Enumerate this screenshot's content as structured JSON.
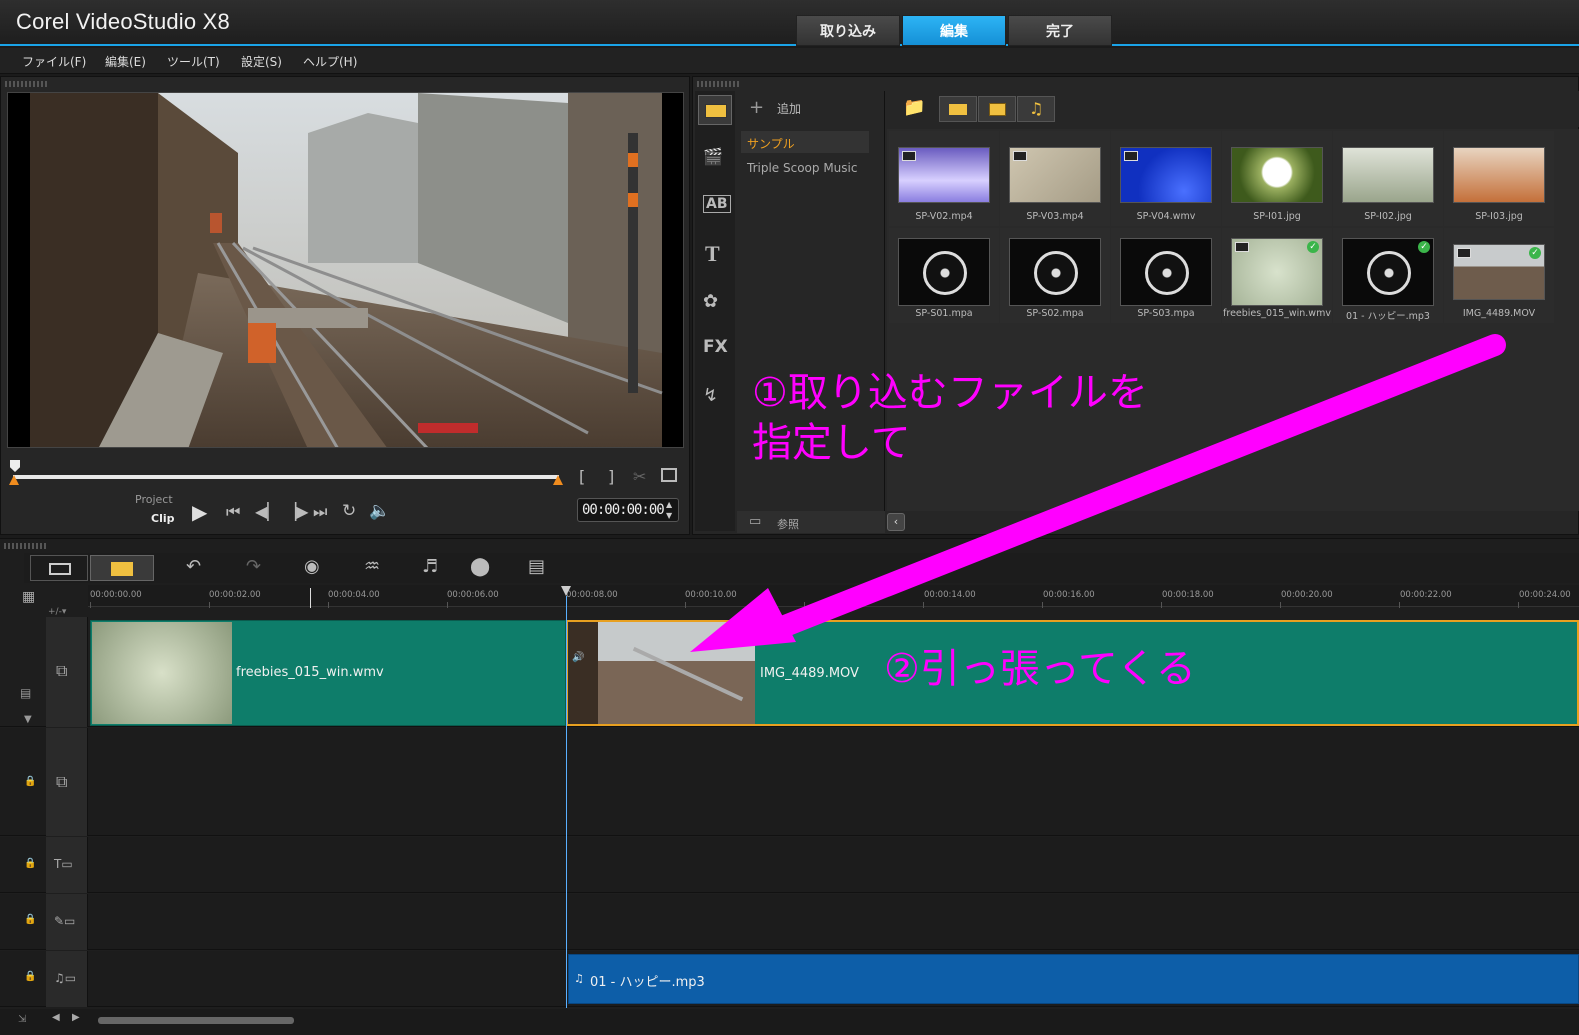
{
  "app": {
    "title": "Corel VideoStudio X8"
  },
  "steps": [
    {
      "label": "取り込み",
      "active": false
    },
    {
      "label": "編集",
      "active": true
    },
    {
      "label": "完了",
      "active": false
    }
  ],
  "menu": [
    "ファイル(F)",
    "編集(E)",
    "ツール(T)",
    "設定(S)",
    "ヘルプ(H)"
  ],
  "player": {
    "mode_project": "Project",
    "mode_clip": "Clip",
    "timecode": "00:00:00:00",
    "mark_in": "[",
    "mark_out": "]"
  },
  "library": {
    "add_label": "追加",
    "browse_label": "参照",
    "folders": [
      {
        "label": "サンプル",
        "selected": true
      },
      {
        "label": "Triple Scoop Music",
        "selected": false
      }
    ],
    "items": [
      {
        "name": "SP-V02.mp4",
        "kind": "video",
        "checked": false
      },
      {
        "name": "SP-V03.mp4",
        "kind": "video",
        "checked": false
      },
      {
        "name": "SP-V04.wmv",
        "kind": "video",
        "checked": false
      },
      {
        "name": "SP-I01.jpg",
        "kind": "image",
        "checked": false
      },
      {
        "name": "SP-I02.jpg",
        "kind": "image",
        "checked": false
      },
      {
        "name": "SP-I03.jpg",
        "kind": "image",
        "checked": false
      },
      {
        "name": "SP-S01.mpa",
        "kind": "audio",
        "checked": false
      },
      {
        "name": "SP-S02.mpa",
        "kind": "audio",
        "checked": false
      },
      {
        "name": "SP-S03.mpa",
        "kind": "audio",
        "checked": false
      },
      {
        "name": "freebies_015_win.wmv",
        "kind": "video",
        "checked": true
      },
      {
        "name": "01 - ハッピー.mp3",
        "kind": "audio",
        "checked": true
      },
      {
        "name": "IMG_4489.MOV",
        "kind": "video",
        "checked": true
      }
    ]
  },
  "annotations": {
    "step1_line1": "①取り込むファイルを",
    "step1_line2": "指定して",
    "step2": "②引っ張ってくる",
    "color": "#ff00ff"
  },
  "timeline": {
    "ruler": [
      "00:00:00.00",
      "00:00:02.00",
      "00:00:04.00",
      "00:00:06.00",
      "00:00:08.00",
      "00:00:10.00",
      "00:00:14.00",
      "00:00:16.00",
      "00:00:18.00",
      "00:00:20.00",
      "00:00:22.00",
      "00:00:24.00"
    ],
    "video_clips": [
      {
        "name": "freebies_015_win.wmv"
      },
      {
        "name": "IMG_4489.MOV"
      }
    ],
    "music_clip": {
      "name": "01 - ハッピー.mp3"
    }
  },
  "colors": {
    "accent": "#1aa3e8",
    "clip_video": "#0e7d6a",
    "clip_music": "#0d5ea8"
  }
}
